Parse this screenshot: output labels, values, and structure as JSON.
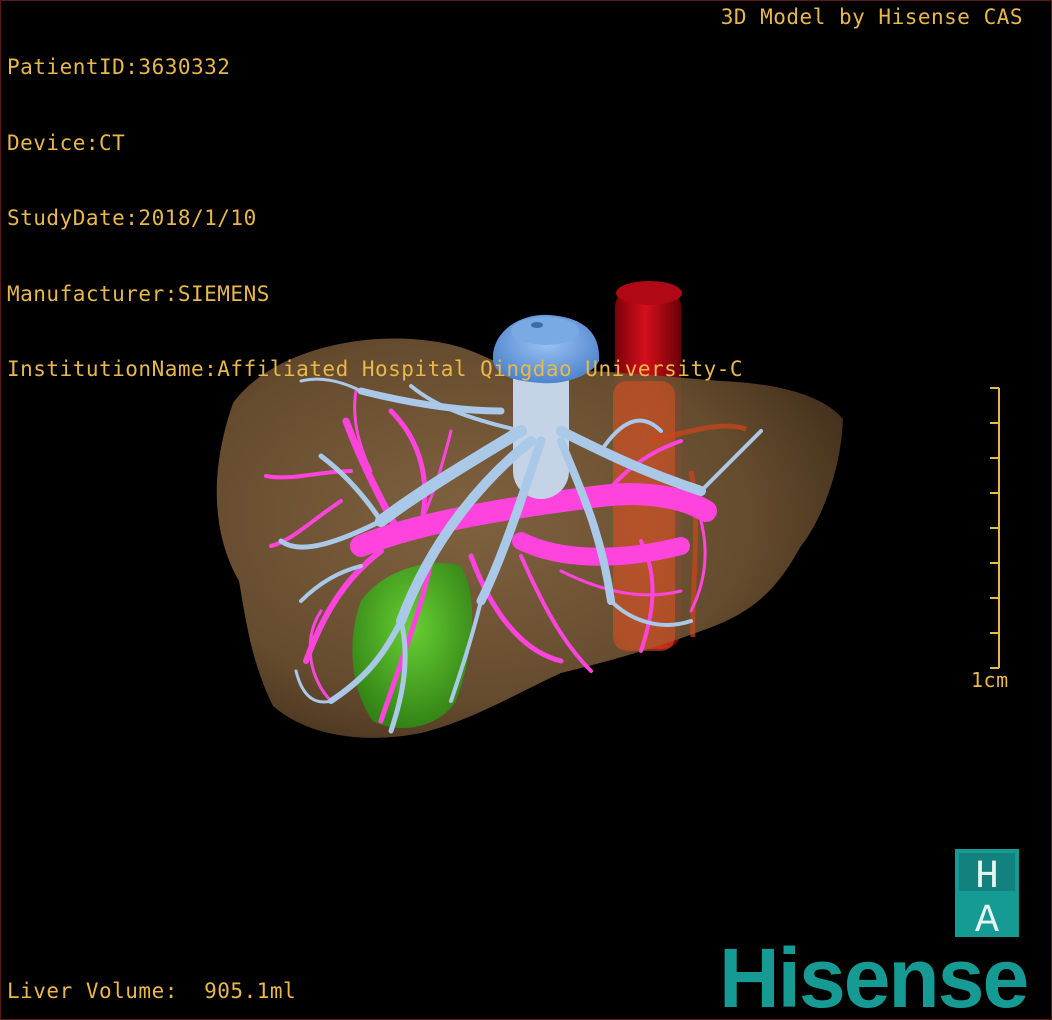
{
  "study_info": {
    "patient_id": "PatientID:3630332",
    "device": "Device:CT",
    "study_date": "StudyDate:2018/1/10",
    "manufacturer": "Manufacturer:SIEMENS",
    "institution": "InstitutionName:Affiliated Hospital Qingdao University-C"
  },
  "model_credit": "3D Model by Hisense CAS",
  "scale": {
    "label": "1cm"
  },
  "liver_volume": "Liver Volume:  905.1ml",
  "branding": {
    "logo_letters": [
      "H",
      "A"
    ],
    "wordmark": "Hisense",
    "brand_color": "#169a94"
  },
  "colors": {
    "overlay_text": "#e8b84a",
    "liver": "#7a5a38",
    "hepatic_vein": "#aac8e8",
    "portal_vein": "#ff44dd",
    "gallbladder": "#44cc22",
    "vena_cava": "#c00010",
    "background": "#000000"
  }
}
